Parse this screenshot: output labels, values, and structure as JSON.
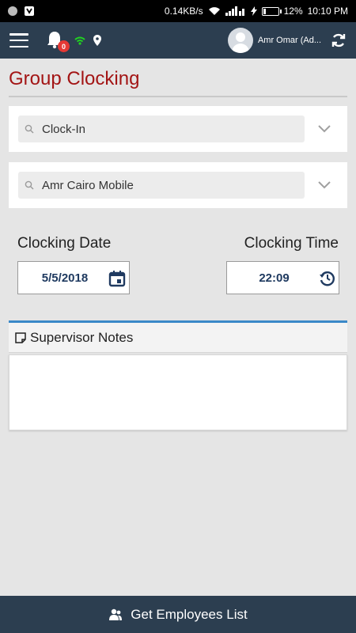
{
  "status_bar": {
    "net_speed": "0.14KB/s",
    "battery": "12%",
    "time": "10:10 PM"
  },
  "app_bar": {
    "notification_count": "0",
    "user_name": "Amr Omar (Ad...",
    "colors": {
      "background": "#2c3e50",
      "wifi": "#21d321",
      "badge": "#e53935"
    }
  },
  "page": {
    "title": "Group Clocking",
    "title_color": "#a31515"
  },
  "clock_type_select": {
    "value": "Clock-In",
    "icon": "search-icon"
  },
  "branch_select": {
    "value": "Amr Cairo Mobile",
    "icon": "search-icon"
  },
  "clocking": {
    "date_label": "Clocking Date",
    "date_value": "5/5/2018",
    "time_label": "Clocking Time",
    "time_value": "22:09"
  },
  "notes": {
    "label": "Supervisor Notes",
    "value": ""
  },
  "bottom_button": {
    "label": "Get Employees List",
    "icon": "people-icon"
  }
}
